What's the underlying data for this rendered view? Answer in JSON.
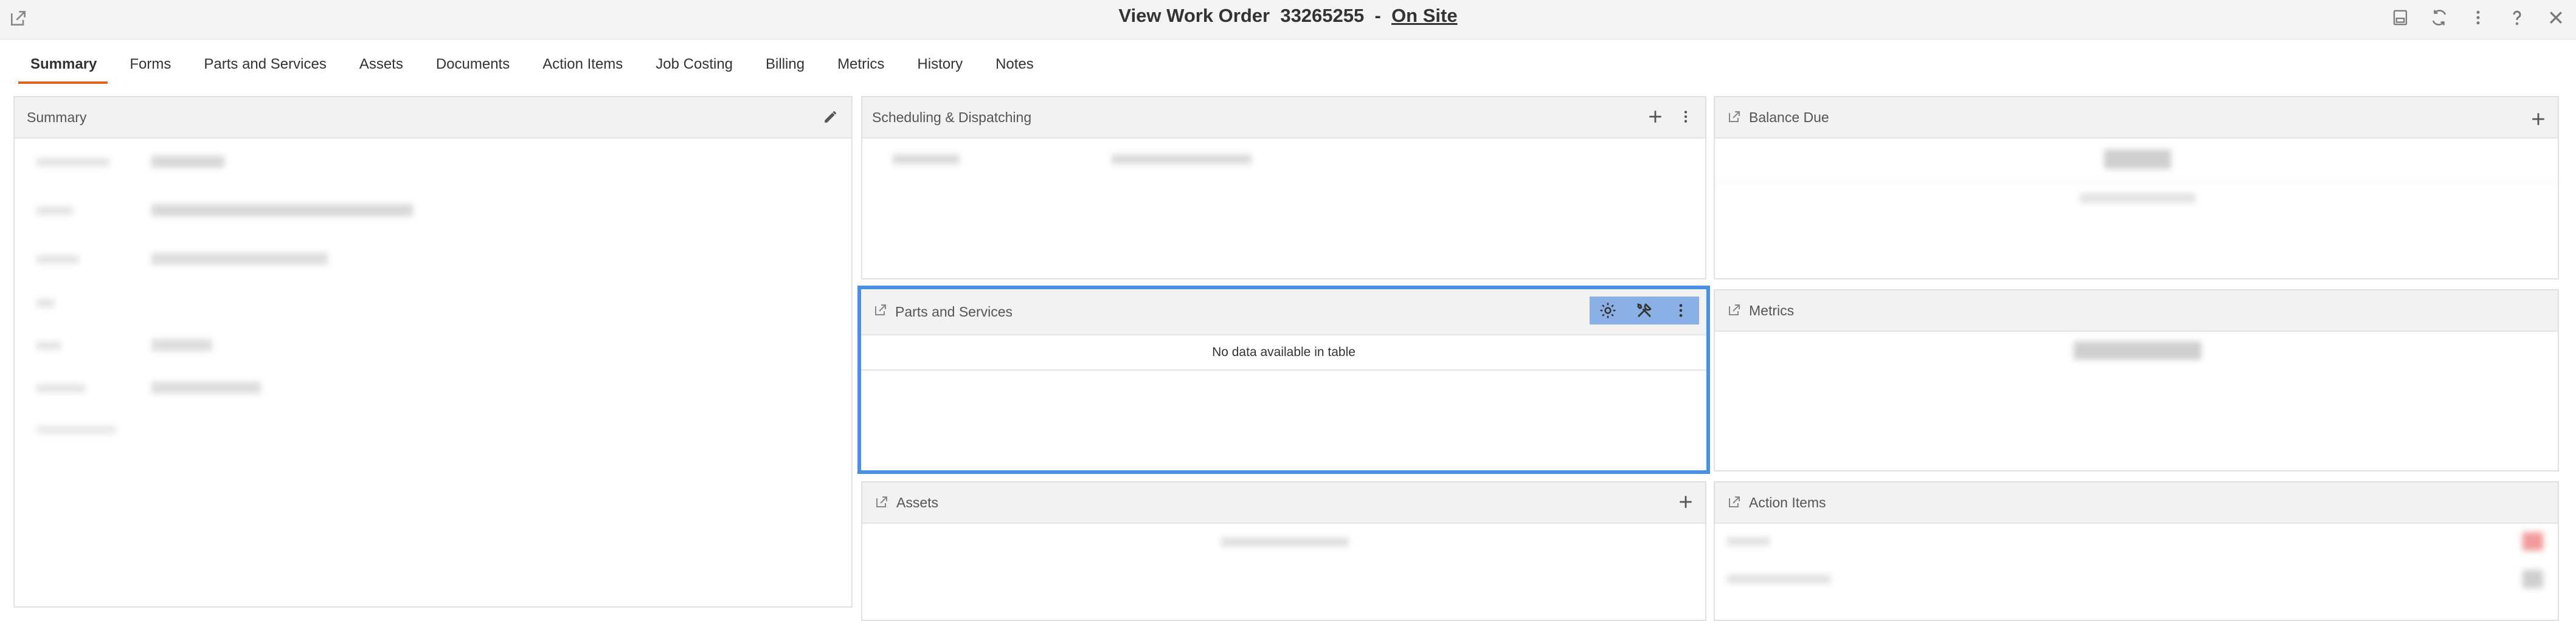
{
  "header": {
    "title_prefix": "View Work Order",
    "work_order_number": "33265255",
    "separator": "-",
    "status": "On Site"
  },
  "top_icons": [
    "save-icon",
    "refresh-icon",
    "more-icon",
    "help-icon",
    "close-icon"
  ],
  "tabs": [
    {
      "label": "Summary",
      "active": true
    },
    {
      "label": "Forms"
    },
    {
      "label": "Parts and Services"
    },
    {
      "label": "Assets"
    },
    {
      "label": "Documents"
    },
    {
      "label": "Action Items"
    },
    {
      "label": "Job Costing"
    },
    {
      "label": "Billing"
    },
    {
      "label": "Metrics"
    },
    {
      "label": "History"
    },
    {
      "label": "Notes"
    }
  ],
  "panels": {
    "summary": {
      "title": "Summary"
    },
    "scheduling": {
      "title": "Scheduling & Dispatching"
    },
    "balance": {
      "title": "Balance Due"
    },
    "parts": {
      "title": "Parts and Services",
      "empty_text": "No data available in table"
    },
    "metrics": {
      "title": "Metrics"
    },
    "assets": {
      "title": "Assets"
    },
    "action_items": {
      "title": "Action Items"
    }
  },
  "colors": {
    "accent": "#e2611b",
    "highlight": "#4a90e2",
    "toolbar": "#8ab0e6"
  }
}
